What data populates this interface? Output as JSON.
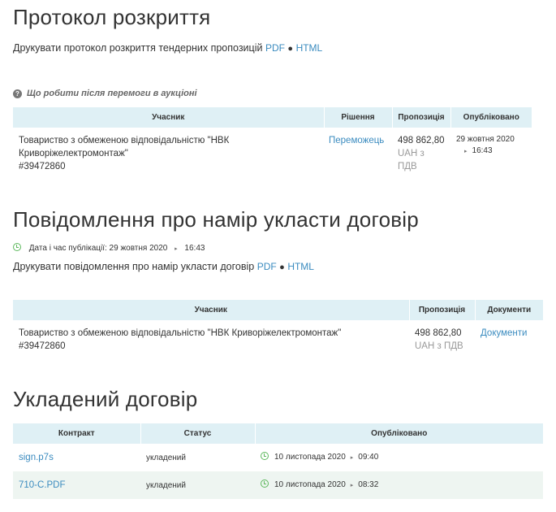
{
  "section1": {
    "title": "Протокол розкриття",
    "print_text": "Друкувати протокол розкриття тендерних пропозицій",
    "link_pdf": "PDF",
    "separator": "●",
    "link_html": "HTML",
    "help_text": "Що робити після перемоги в аукціоні",
    "columns": [
      "Учасник",
      "Рішення",
      "Пропозиція",
      "Опубліковано"
    ],
    "row": {
      "participant_line1": "Товариство з обмеженою відповідальністю \"НВК",
      "participant_line2": "Криворіжелектромонтаж\"",
      "participant_id": "#39472860",
      "decision": "Переможець",
      "amount": "498 862,80",
      "currency_line1": "UAH з",
      "currency_line2": "ПДВ",
      "published_date": "29 жовтня 2020",
      "published_time": "16:43"
    }
  },
  "section2": {
    "title": "Повідомлення про намір укласти договір",
    "pub_label": "Дата і час публікації: 29 жовтня 2020",
    "pub_time": "16:43",
    "print_text": "Друкувати повідомлення про намір укласти договір",
    "link_pdf": "PDF",
    "separator": "●",
    "link_html": "HTML",
    "columns": [
      "Учасник",
      "Пропозиція",
      "Документи"
    ],
    "row": {
      "participant_line1": "Товариство з обмеженою відповідальністю \"НВК Криворіжелектромонтаж\"",
      "participant_id": "#39472860",
      "amount": "498 862,80",
      "currency": "UAH з ПДВ",
      "documents": "Документи"
    }
  },
  "section3": {
    "title": "Укладений договір",
    "columns": [
      "Контракт",
      "Статус",
      "Опубліковано"
    ],
    "rows": [
      {
        "contract": "sign.p7s",
        "status": "укладений",
        "date": "10 листопада 2020",
        "time": "09:40"
      },
      {
        "contract": "710-С.PDF",
        "status": "укладений",
        "date": "10 листопада 2020",
        "time": "08:32"
      }
    ]
  },
  "colors": {
    "link": "#3a8bbf",
    "header_bg": "#dff0f5",
    "alt_row_bg": "#eef5f1",
    "clock": "#5cb85c"
  }
}
